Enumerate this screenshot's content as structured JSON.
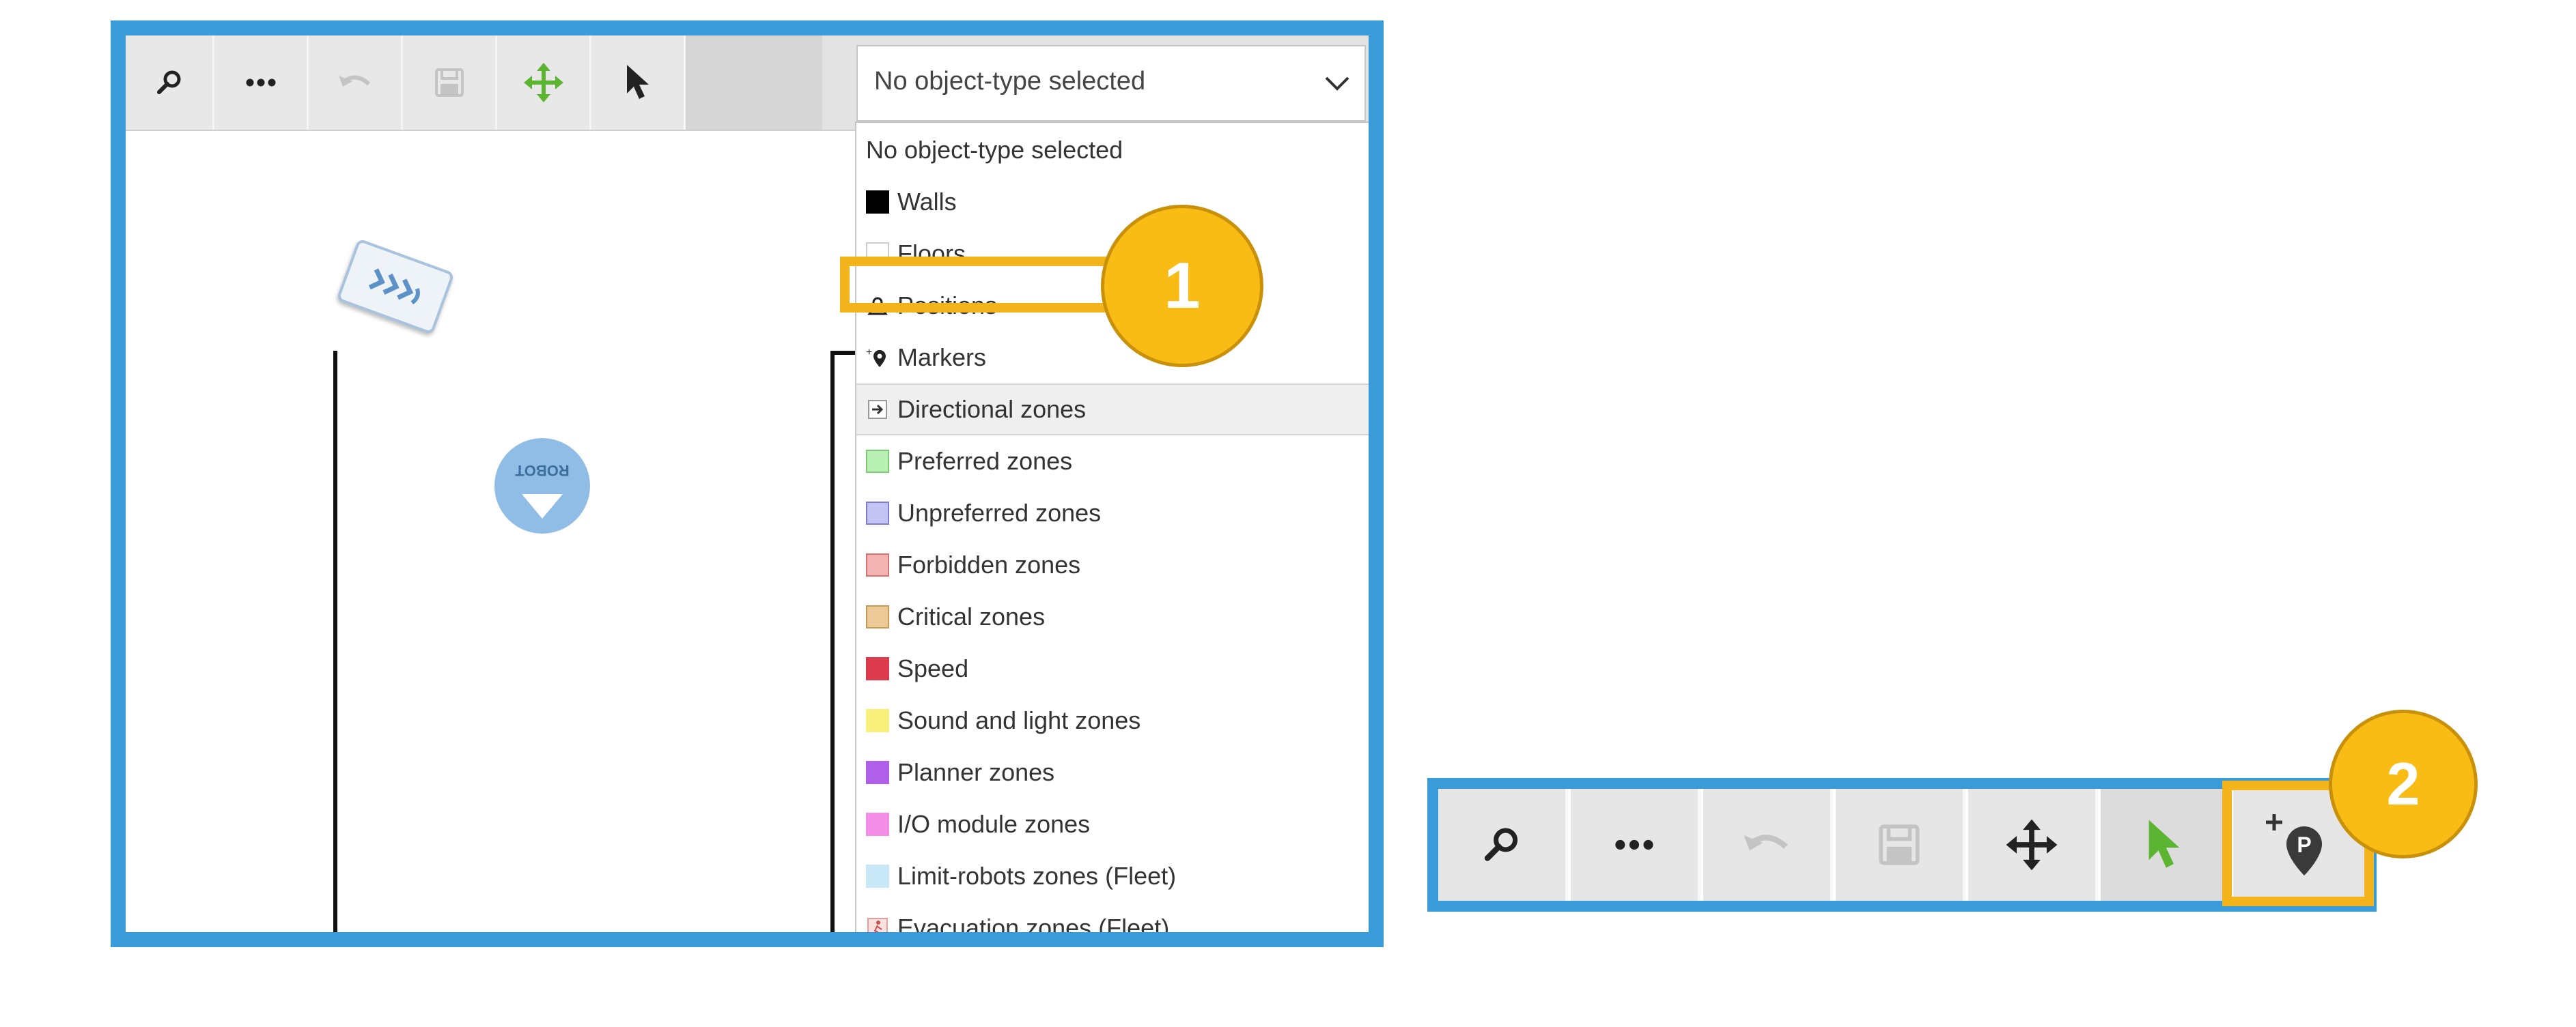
{
  "toolbar": {
    "buttons": [
      {
        "name": "zoom-button",
        "icon": "magnifier-icon"
      },
      {
        "name": "more-button",
        "icon": "ellipsis-icon"
      },
      {
        "name": "undo-button",
        "icon": "undo-icon",
        "state": "disabled"
      },
      {
        "name": "save-button",
        "icon": "save-icon",
        "state": "disabled"
      },
      {
        "name": "move-button",
        "icon": "move-arrows-icon"
      },
      {
        "name": "select-button",
        "icon": "cursor-arrow-icon"
      }
    ],
    "colors": {
      "accent_green": "#5cb531",
      "frame_blue": "#3a9bd9",
      "highlight_yellow": "#f2b31b"
    }
  },
  "object_type_select": {
    "selected": "No object-type selected",
    "options": [
      {
        "label": "No object-type selected",
        "marker": "none"
      },
      {
        "label": "Walls",
        "marker": "swatch",
        "color": "#000000"
      },
      {
        "label": "Floors",
        "marker": "swatch",
        "color": "#ffffff"
      },
      {
        "label": "Positions",
        "marker": "position-icon"
      },
      {
        "label": "Markers",
        "marker": "marker-icon"
      },
      {
        "label": "Directional zones",
        "marker": "directional-icon",
        "group": true
      },
      {
        "label": "Preferred zones",
        "marker": "swatch",
        "color": "#b9f0b4"
      },
      {
        "label": "Unpreferred zones",
        "marker": "swatch",
        "color": "#c4c4f4"
      },
      {
        "label": "Forbidden zones",
        "marker": "swatch",
        "color": "#f5b4b4"
      },
      {
        "label": "Critical zones",
        "marker": "swatch",
        "color": "#eec998"
      },
      {
        "label": "Speed",
        "marker": "swatch",
        "color": "#dd3b4d"
      },
      {
        "label": "Sound and light zones",
        "marker": "swatch",
        "color": "#f8f07a"
      },
      {
        "label": "Planner zones",
        "marker": "swatch",
        "color": "#b060e8"
      },
      {
        "label": "I/O module zones",
        "marker": "swatch",
        "color": "#f48ee6"
      },
      {
        "label": "Limit-robots zones (Fleet)",
        "marker": "swatch",
        "color": "#c8e8f8"
      },
      {
        "label": "Evacuation zones (Fleet)",
        "marker": "evacuation-icon"
      }
    ]
  },
  "map": {
    "robot_label": "ROBOT"
  },
  "toolbar2": {
    "buttons": [
      {
        "name": "zoom-button",
        "icon": "magnifier-icon"
      },
      {
        "name": "more-button",
        "icon": "ellipsis-icon"
      },
      {
        "name": "undo-button",
        "icon": "undo-icon",
        "state": "disabled"
      },
      {
        "name": "save-button",
        "icon": "save-icon",
        "state": "disabled"
      },
      {
        "name": "move-button",
        "icon": "move-arrows-icon"
      },
      {
        "name": "select-button",
        "icon": "cursor-arrow-icon",
        "state": "active"
      },
      {
        "name": "add-position-button",
        "icon": "add-position-icon",
        "label": "P"
      }
    ]
  },
  "callouts": [
    "1",
    "2"
  ]
}
